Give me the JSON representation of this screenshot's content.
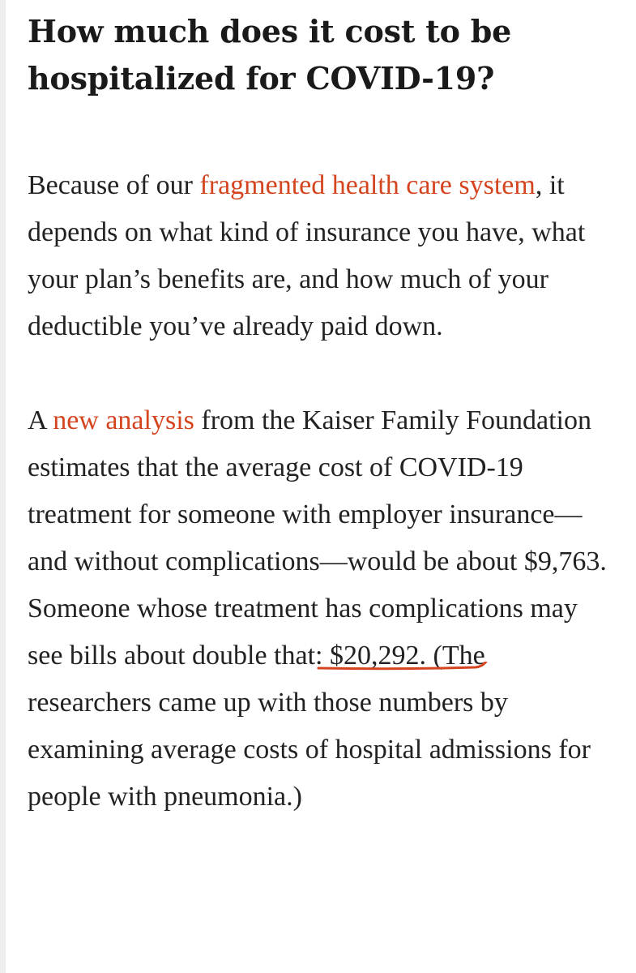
{
  "headline": "How much does it cost to be hospitalized for COVID-19?",
  "paragraph1": {
    "link_text": "fragmented health care system",
    "before_link": "Because of our ",
    "after_link": ", it depends on what kind of insurance you have, what your plan’s benefits are, and how much of your deductible you’ve already paid down."
  },
  "paragraph2": {
    "before_link": "A ",
    "link_text": "new analysis",
    "after_link": " from the Kaiser Family Foundation estimates that the average cost of COVID-19 treatment for someone with employer insurance—and without complications—would be about $9,763. Someone whose treatment has complications may see bills about double that: ",
    "highlighted_amount": "$20,292.",
    "after_highlight": " (The researchers came up with those numbers by examining average costs of hospital admissions for people with pneumonia.)"
  },
  "colors": {
    "link": "#d4451f",
    "annotation_underline": "#d4451f",
    "text": "#222222"
  }
}
